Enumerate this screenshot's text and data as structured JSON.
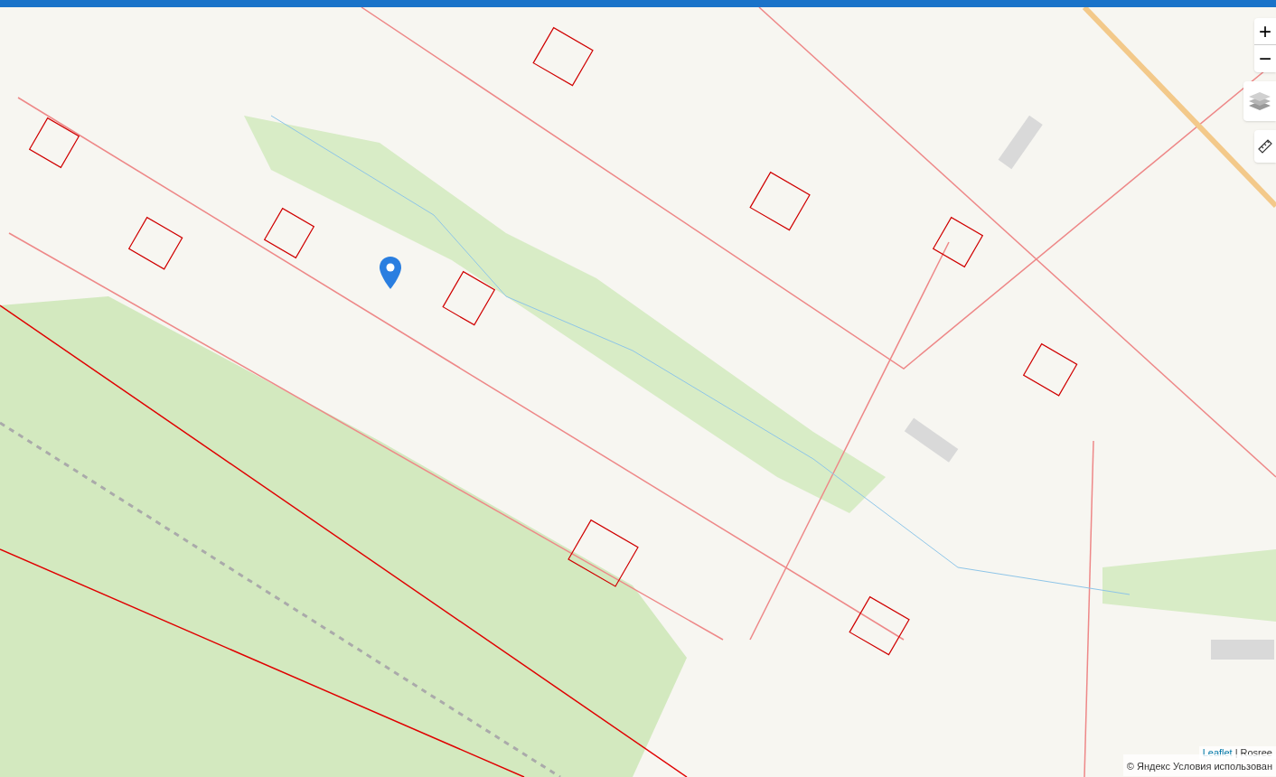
{
  "zoom_controls": {
    "zoom_in": "+",
    "zoom_out": "−"
  },
  "attribution": {
    "link": "Leaflet",
    "separator": "|",
    "source": "Rosree",
    "copyright": "© Яндекс Условия использован"
  }
}
